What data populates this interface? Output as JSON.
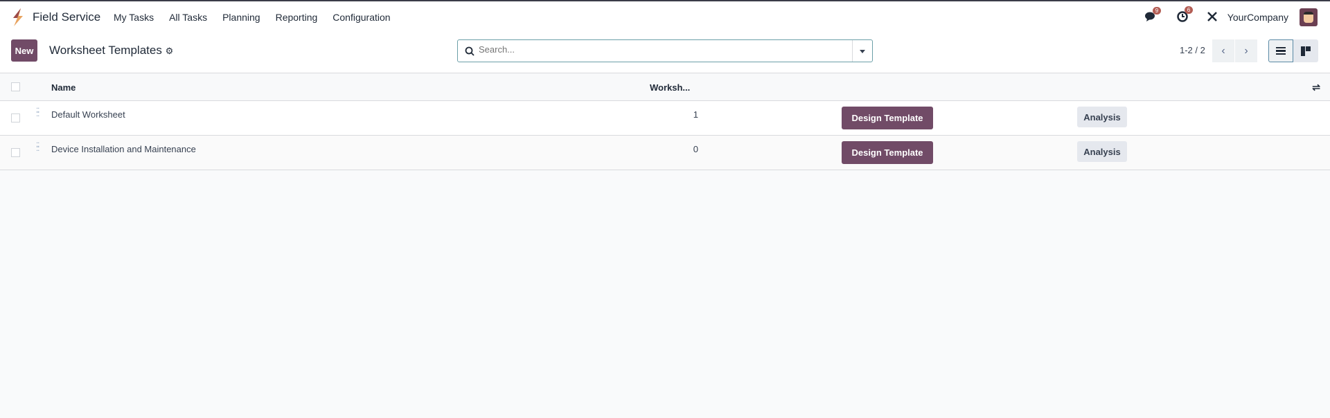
{
  "nav": {
    "app_name": "Field Service",
    "menu": [
      "My Tasks",
      "All Tasks",
      "Planning",
      "Reporting",
      "Configuration"
    ],
    "messages_count": "9",
    "activities_count": "6",
    "company": "YourCompany"
  },
  "control": {
    "new_label": "New",
    "title": "Worksheet Templates",
    "search_placeholder": "Search...",
    "pager": "1-2 / 2"
  },
  "table": {
    "columns": [
      "Name",
      "Worksh..."
    ],
    "rows": [
      {
        "name": "Default Worksheet",
        "count": "1",
        "design": "Design Template",
        "analysis": "Analysis"
      },
      {
        "name": "Device Installation and Maintenance",
        "count": "0",
        "design": "Design Template",
        "analysis": "Analysis"
      }
    ]
  },
  "colors": {
    "brand": "#714b67",
    "badge": "#b35d54"
  }
}
